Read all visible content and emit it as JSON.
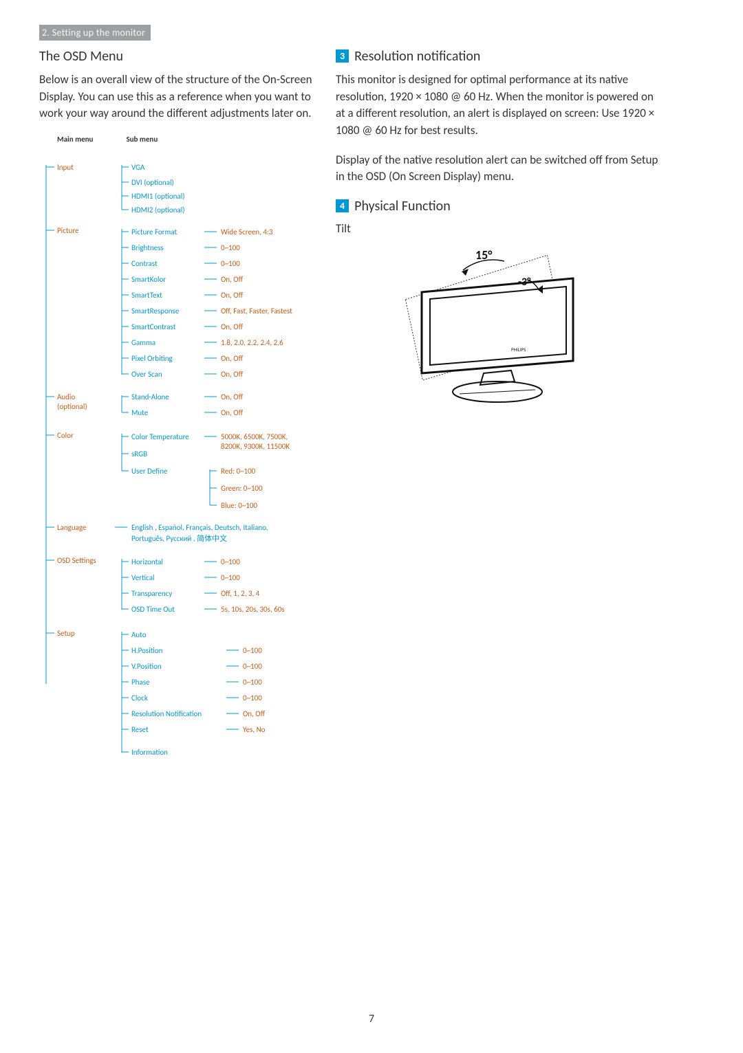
{
  "header": {
    "section": "2. Setting up the monitor"
  },
  "left": {
    "title": "The OSD Menu",
    "intro": "Below is an overall view of the structure of the On-Screen Display. You can use this as a reference when you want to work your way around the different adjustments later on.",
    "main_menu_label": "Main menu",
    "sub_menu_label": "Sub menu",
    "menu": {
      "Input": {
        "subs": [
          "VGA",
          "DVI (optional)",
          "HDMI1 (optional)",
          "HDMI2 (optional)"
        ]
      },
      "Picture": {
        "subs": [
          {
            "name": "Picture Format",
            "vals": "Wide Screen, 4:3"
          },
          {
            "name": "Brightness",
            "vals": "0~100"
          },
          {
            "name": "Contrast",
            "vals": "0~100"
          },
          {
            "name": "SmartKolor",
            "vals": "On, Off"
          },
          {
            "name": "SmartText",
            "vals": "On, Off"
          },
          {
            "name": "SmartResponse",
            "vals": "Off, Fast, Faster, Fastest"
          },
          {
            "name": "SmartContrast",
            "vals": "On, Off"
          },
          {
            "name": "Gamma",
            "vals": "1.8, 2.0, 2.2, 2.4, 2.6"
          },
          {
            "name": "Pixel Orbiting",
            "vals": "On, Off"
          },
          {
            "name": "Over Scan",
            "vals": "On, Off"
          }
        ]
      },
      "Audio": {
        "label": "Audio\n(optional)",
        "subs": [
          {
            "name": "Stand-Alone",
            "vals": "On, Off"
          },
          {
            "name": "Mute",
            "vals": "On, Off"
          }
        ]
      },
      "Color": {
        "subs": [
          {
            "name": "Color Temperature",
            "vals": "5000K, 6500K, 7500K,\n8200K, 9300K, 11500K"
          },
          {
            "name": "sRGB"
          },
          {
            "name": "User Define",
            "children": [
              "Red: 0~100",
              "Green: 0~100",
              "Blue: 0~100"
            ]
          }
        ]
      },
      "Language": {
        "vals": "English , Español, Français, Deutsch, Italiano,\nPortuguês, Русский , 简体中文"
      },
      "OSD Settings": {
        "subs": [
          {
            "name": "Horizontal",
            "vals": "0~100"
          },
          {
            "name": "Vertical",
            "vals": "0~100"
          },
          {
            "name": "Transparency",
            "vals": "Off, 1, 2, 3, 4"
          },
          {
            "name": "OSD Time Out",
            "vals": "5s, 10s, 20s, 30s, 60s"
          }
        ]
      },
      "Setup": {
        "subs": [
          {
            "name": "Auto"
          },
          {
            "name": "H.Position",
            "vals": "0~100"
          },
          {
            "name": "V.Position",
            "vals": "0~100"
          },
          {
            "name": "Phase",
            "vals": "0~100"
          },
          {
            "name": "Clock",
            "vals": "0~100"
          },
          {
            "name": "Resolution Notification",
            "vals": "On, Off"
          },
          {
            "name": "Reset",
            "vals": "Yes, No"
          },
          {
            "name": "Information"
          }
        ]
      }
    }
  },
  "right": {
    "badge3": "3",
    "title3": "Resolution notification",
    "para3a": "This monitor is designed for optimal performance at its native resolution, 1920 × 1080 @ 60 Hz. When the monitor is powered on at a different resolution, an alert is displayed on screen: Use 1920 × 1080 @ 60 Hz for best results.",
    "para3b": "Display of the native resolution alert can be switched off from Setup in the OSD (On Screen Display) menu.",
    "badge4": "4",
    "title4": "Physical Function",
    "tilt_label": "Tilt",
    "angle_up": "15°",
    "angle_down": "-3°",
    "brand": "PHILIPS"
  },
  "page": "7"
}
